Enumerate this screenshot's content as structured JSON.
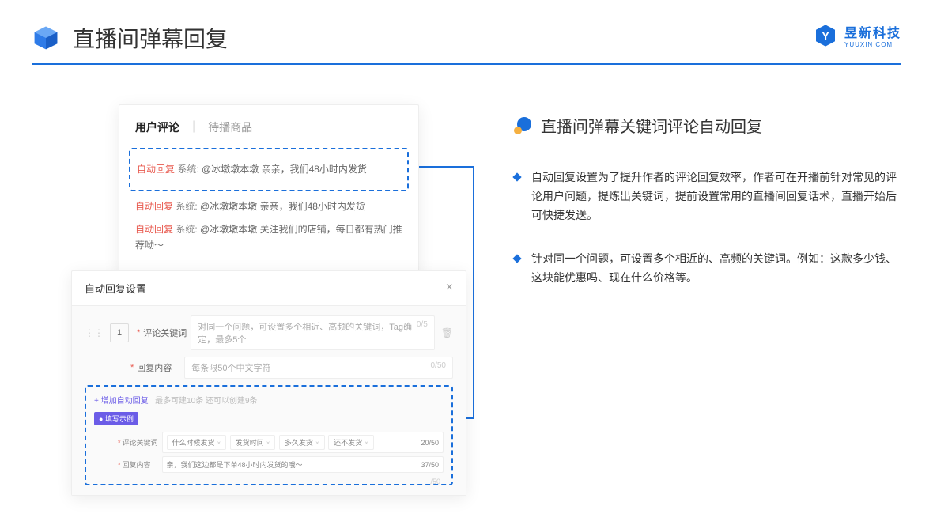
{
  "header": {
    "title": "直播间弹幕回复"
  },
  "brand": {
    "name": "昱新科技",
    "sub": "YUUXIN.COM"
  },
  "card1": {
    "tab_active": "用户评论",
    "tab_inactive": "待播商品",
    "msg1_tag": "自动回复",
    "msg1_sys": "系统:",
    "msg1_text": "@冰墩墩本墩 亲亲，我们48小时内发货",
    "msg2_tag": "自动回复",
    "msg2_sys": "系统:",
    "msg2_text": "@冰墩墩本墩 亲亲，我们48小时内发货",
    "msg3_tag": "自动回复",
    "msg3_sys": "系统:",
    "msg3_text": "@冰墩墩本墩 关注我们的店铺，每日都有热门推荐呦～"
  },
  "card2": {
    "title": "自动回复设置",
    "num": "1",
    "row1_label": "评论关键词",
    "row1_placeholder": "对同一个问题，可设置多个相近、高频的关键词，Tag确定，最多5个",
    "row1_count": "0/5",
    "row2_label": "回复内容",
    "row2_placeholder": "每条限50个中文字符",
    "row2_count": "0/50",
    "add_link": "+ 增加自动回复",
    "add_tip": "最多可建10条 还可以创建9条",
    "badge": "● 填写示例",
    "ex1_label": "评论关键词",
    "ex1_tag1": "什么时候发货",
    "ex1_tag2": "发货时间",
    "ex1_tag3": "多久发货",
    "ex1_tag4": "还不发货",
    "ex1_count": "20/50",
    "ex2_label": "回复内容",
    "ex2_text": "亲，我们这边都是下单48小时内发货的哦～",
    "ex2_count": "37/50",
    "bottom_count": "/50"
  },
  "right": {
    "heading": "直播间弹幕关键词评论自动回复",
    "bullet1": "自动回复设置为了提升作者的评论回复效率，作者可在开播前针对常见的评论用户问题，提炼出关键词，提前设置常用的直播间回复话术，直播开始后可快捷发送。",
    "bullet2": "针对同一个问题，可设置多个相近的、高频的关键词。例如：这款多少钱、这块能优惠吗、现在什么价格等。"
  }
}
